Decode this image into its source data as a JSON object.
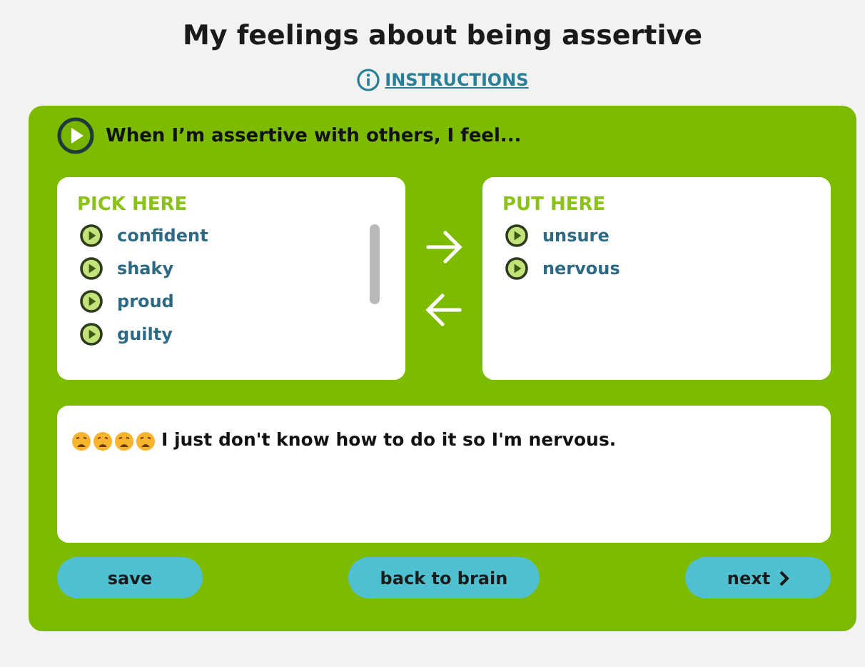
{
  "title": "My feelings about being assertive",
  "instructions_link": "INSTRUCTIONS",
  "prompt": "When I’m assertive with others, I feel...",
  "lists": [
    {
      "heading": "PICK HERE",
      "items": [
        "confident",
        "shaky",
        "proud",
        "guilty"
      ]
    },
    {
      "heading": "PUT HERE",
      "items": [
        "unsure",
        "nervous"
      ]
    }
  ],
  "answer": {
    "value": "I just don't know how to do it so I'm nervous."
  },
  "buttons": [
    {
      "label": "save",
      "kind": "plain"
    },
    {
      "label": "back to brain",
      "kind": "plain"
    },
    {
      "label": "next",
      "kind": "forward"
    }
  ]
}
